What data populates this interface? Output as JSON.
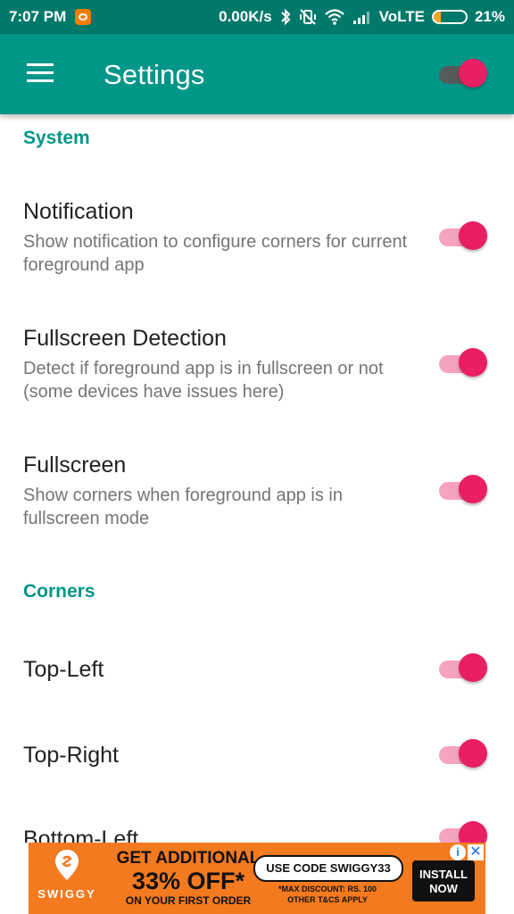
{
  "status_bar": {
    "time": "7:07 PM",
    "network_speed": "0.00K/s",
    "network_type": "VoLTE",
    "battery_percent": "21%",
    "battery_level": 0.21,
    "icons": [
      "app-notification-icon",
      "bluetooth-icon",
      "vibrate-off-icon",
      "wifi-icon",
      "signal-icon",
      "battery-icon"
    ]
  },
  "app_bar": {
    "title": "Settings",
    "master_switch_on": true
  },
  "sections": {
    "system": {
      "header": "System",
      "items": [
        {
          "title": "Notification",
          "description": "Show notification to configure corners for current foreground app",
          "enabled": true
        },
        {
          "title": "Fullscreen Detection",
          "description": "Detect if foreground app is in fullscreen or not (some devices have issues here)",
          "enabled": true
        },
        {
          "title": "Fullscreen",
          "description": "Show corners when foreground app is in fullscreen mode",
          "enabled": true
        }
      ]
    },
    "corners": {
      "header": "Corners",
      "items": [
        {
          "title": "Top-Left",
          "enabled": true
        },
        {
          "title": "Top-Right",
          "enabled": true
        },
        {
          "title": "Bottom-Left",
          "enabled": true
        }
      ]
    }
  },
  "ad": {
    "brand": "SWIGGY",
    "headline_top": "GET ADDITIONAL",
    "headline_big": "33% OFF*",
    "headline_sub": "ON YOUR FIRST ORDER",
    "code": "USE CODE SWIGGY33",
    "fine_print_1": "*MAX DISCOUNT: RS. 100",
    "fine_print_2": "OTHER T&CS APPLY",
    "install_line1": "INSTALL",
    "install_line2": "NOW",
    "info_glyph": "i",
    "close_glyph": "✕"
  },
  "colors": {
    "status_bar": "#00796b",
    "app_bar": "#009688",
    "accent": "#e91e63",
    "section_header": "#009688",
    "ad_background": "#f47a1f"
  }
}
